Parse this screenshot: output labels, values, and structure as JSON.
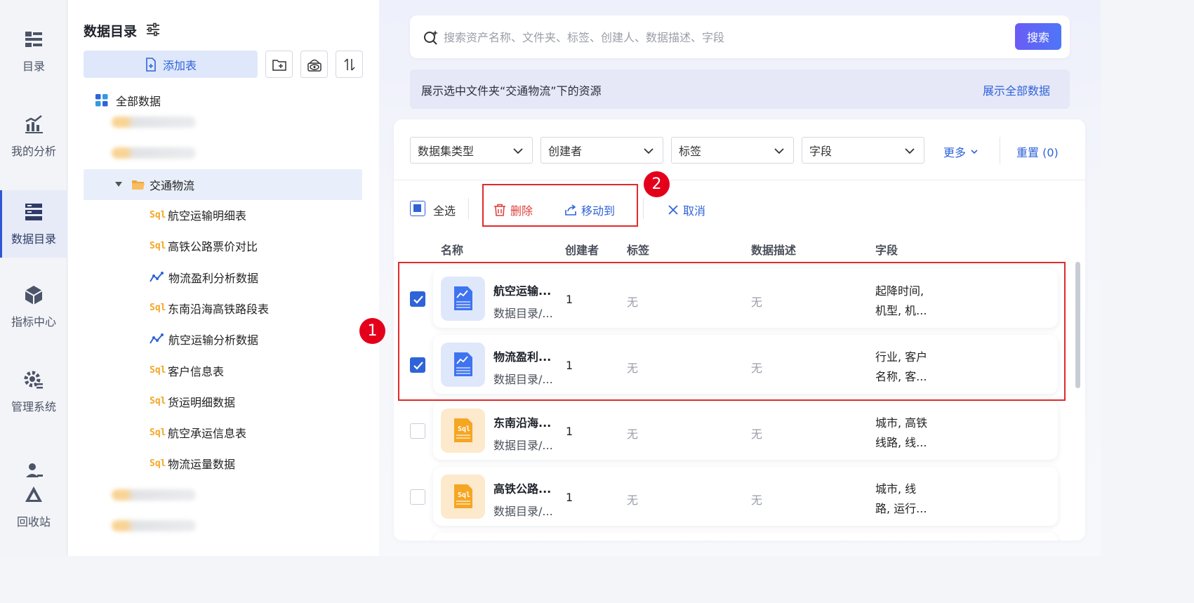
{
  "rail": {
    "items": [
      {
        "label": "目录",
        "icon": "catalog-icon"
      },
      {
        "label": "我的分析",
        "icon": "analysis-icon"
      },
      {
        "label": "数据目录",
        "icon": "data-catalog-icon",
        "active": true
      },
      {
        "label": "指标中心",
        "icon": "metric-icon"
      },
      {
        "label": "管理系统",
        "icon": "admin-gear-icon"
      },
      {
        "label": "回收站",
        "icon": "recycle-icon"
      }
    ]
  },
  "tree": {
    "title": "数据目录",
    "add_table_label": "添加表",
    "root_label": "全部数据",
    "selected_folder": "交通物流",
    "children": [
      {
        "label": "航空运输明细表",
        "type": "sql"
      },
      {
        "label": "高铁公路票价对比",
        "type": "sql"
      },
      {
        "label": "物流盈利分析数据",
        "type": "chart"
      },
      {
        "label": "东南沿海高铁路段表",
        "type": "sql"
      },
      {
        "label": "航空运输分析数据",
        "type": "chart"
      },
      {
        "label": "客户信息表",
        "type": "sql"
      },
      {
        "label": "货运明细数据",
        "type": "sql"
      },
      {
        "label": "航空承运信息表",
        "type": "sql"
      },
      {
        "label": "物流运量数据",
        "type": "sql"
      }
    ]
  },
  "search": {
    "placeholder": "搜索资产名称、文件夹、标签、创建人、数据描述、字段",
    "button_label": "搜索"
  },
  "notice": {
    "text": "展示选中文件夹“交通物流”下的资源",
    "link": "展示全部数据"
  },
  "filters": {
    "items": [
      "数据集类型",
      "创建者",
      "标签",
      "字段"
    ],
    "more_label": "更多",
    "reset_label": "重置 (0)"
  },
  "actions": {
    "select_all": "全选",
    "delete": "删除",
    "move_to": "移动到",
    "cancel": "取消"
  },
  "badges": {
    "one": "1",
    "two": "2"
  },
  "table": {
    "headers": [
      "名称",
      "创建者",
      "标签",
      "数据描述",
      "字段"
    ],
    "rows": [
      {
        "name": "航空运输...",
        "path": "数据目录/...",
        "creator": "1",
        "tag": "无",
        "desc": "无",
        "field_line1": "起降时间,",
        "field_line2": "机型, 机...",
        "checked": true,
        "kind": "chart"
      },
      {
        "name": "物流盈利...",
        "path": "数据目录/...",
        "creator": "1",
        "tag": "无",
        "desc": "无",
        "field_line1": "行业, 客户",
        "field_line2": "名称, 客...",
        "checked": true,
        "kind": "chart"
      },
      {
        "name": "东南沿海...",
        "path": "数据目录/...",
        "creator": "1",
        "tag": "无",
        "desc": "无",
        "field_line1": "城市, 高铁",
        "field_line2": "线路, 线...",
        "checked": false,
        "kind": "sql"
      },
      {
        "name": "高铁公路...",
        "path": "数据目录/...",
        "creator": "1",
        "tag": "无",
        "desc": "无",
        "field_line1": "城市, 线",
        "field_line2": "路, 运行...",
        "checked": false,
        "kind": "sql"
      }
    ]
  },
  "colors": {
    "accent": "#2f63d8",
    "danger": "#e0403c",
    "highlight": "#e02a2a"
  }
}
